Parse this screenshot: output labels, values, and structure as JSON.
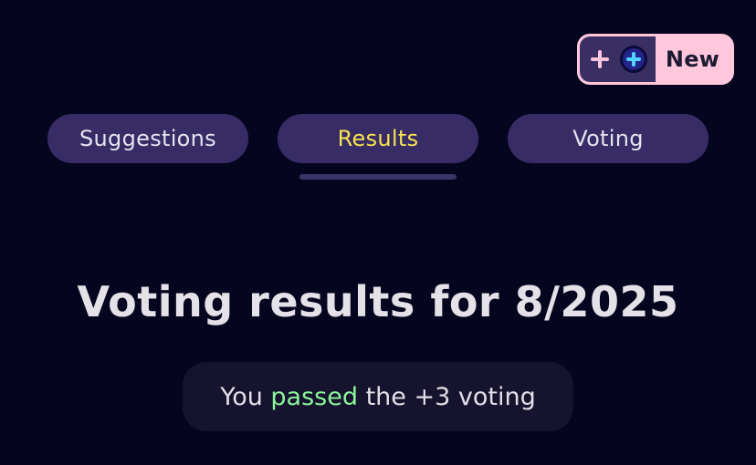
{
  "header": {
    "new_button": {
      "label": "New",
      "icons": [
        "plus-icon",
        "plus-circle-icon"
      ],
      "background": "#ffc7dc",
      "icon_box_background": "#3a2f63"
    }
  },
  "tabs": {
    "active": "Results",
    "items": [
      {
        "label": "Suggestions"
      },
      {
        "label": "Results"
      },
      {
        "label": "Voting"
      }
    ],
    "active_color": "#f7e24f",
    "tab_background": "#372c66"
  },
  "main": {
    "title": "Voting results for 8/2025",
    "result": {
      "prefix": "You",
      "status": "passed",
      "suffix": "the +3 voting",
      "status_color": "#8ef59a"
    }
  },
  "colors": {
    "page_background": "#05051f"
  }
}
